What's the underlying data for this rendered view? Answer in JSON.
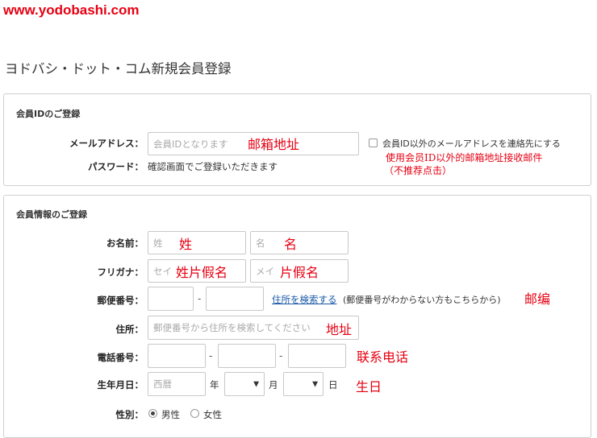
{
  "logo": "www.yodobashi.com",
  "page_title": "ヨドバシ・ドット・コム新規会員登録",
  "member_id": {
    "section_title": "会員IDのご登録",
    "email_label": "メールアドレス：",
    "email_placeholder": "会員IDとなります",
    "email_note": "邮箱地址",
    "checkbox_label": "会員ID以外のメールアドレスを連絡先にする",
    "checkbox_note_line1": "使用会员ID以外的邮箱地址接收邮件",
    "checkbox_note_line2": "（不推荐点击）",
    "password_label": "パスワード：",
    "password_text": "確認画面でご登録いただきます"
  },
  "member_info": {
    "section_title": "会員情報のご登録",
    "name_label": "お名前：",
    "last_name_placeholder": "姓",
    "last_name_note": "姓",
    "first_name_placeholder": "名",
    "first_name_note": "名",
    "kana_label": "フリガナ：",
    "kana_last_placeholder": "セイ",
    "kana_last_note": "姓片假名",
    "kana_first_placeholder": "メイ",
    "kana_first_note": "片假名",
    "postal_label": "郵便番号：",
    "postal_sep": "-",
    "postal_search_link": "住所を検索する",
    "postal_hint": "(郵便番号がわからない方もこちらから)",
    "postal_note": "邮编",
    "address_label": "住所：",
    "address_placeholder": "郵便番号から住所を検索してください",
    "address_note": "地址",
    "phone_label": "電話番号：",
    "phone_sep1": "-",
    "phone_sep2": "-",
    "phone_note": "联系电话",
    "birth_label": "生年月日：",
    "birth_year_placeholder": "西暦",
    "birth_year_unit": "年",
    "birth_month_unit": "月",
    "birth_day_unit": "日",
    "birth_note": "生日",
    "gender_label": "性別：",
    "gender_male": "男性",
    "gender_female": "女性",
    "gender_selected": "男性"
  }
}
